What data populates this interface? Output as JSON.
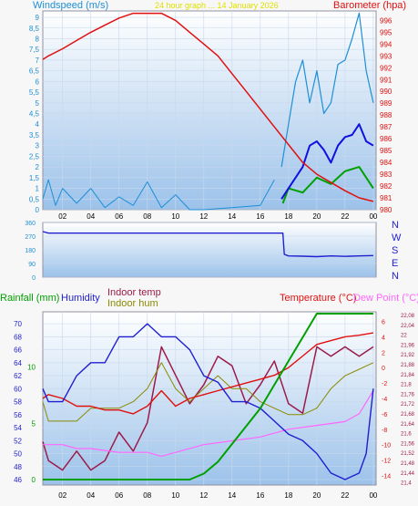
{
  "colors": {
    "wind": "#1e8fd6",
    "wind_avg": "#1010e0",
    "barometer": "#e01010",
    "green": "#00a000",
    "indoor_temp": "#9b1b4b",
    "indoor_hum": "#8a8a00",
    "temperature": "#e01010",
    "dewpoint": "#ff66ff",
    "humidity": "#1f1fd0",
    "rain": "#00a000"
  },
  "chart_data": [
    {
      "type": "line",
      "title": "24 hour graph ... 14 January 2026",
      "ylabel_left": "Windspeed (m/s)",
      "ylabel_right": "Barometer (hpa)",
      "x_ticks": [
        "02",
        "04",
        "06",
        "08",
        "10",
        "12",
        "14",
        "16",
        "18",
        "20",
        "22",
        "00"
      ],
      "y_left_ticks": [
        "0",
        "0,5",
        "1",
        "1,5",
        "2",
        "2,5",
        "3",
        "3,5",
        "4",
        "4,5",
        "5",
        "5,5",
        "6",
        "6,5",
        "7",
        "7,5",
        "8",
        "8,5",
        "9"
      ],
      "y_right_ticks": [
        "980",
        "981",
        "982",
        "983",
        "984",
        "985",
        "986",
        "987",
        "988",
        "989",
        "990",
        "991",
        "992",
        "993",
        "994",
        "995",
        "996"
      ],
      "ylim_left": [
        0,
        9.3
      ],
      "ylim_right": [
        980,
        996.8
      ],
      "xlim": [
        0.6,
        24.2
      ],
      "barometer_series": [
        [
          0.6,
          992.7
        ],
        [
          1,
          993
        ],
        [
          2,
          993.6
        ],
        [
          3,
          994.3
        ],
        [
          4,
          995
        ],
        [
          5,
          995.6
        ],
        [
          6,
          996.2
        ],
        [
          7,
          996.6
        ],
        [
          8,
          996.6
        ],
        [
          9,
          996.6
        ],
        [
          10,
          996
        ],
        [
          11,
          995
        ],
        [
          12,
          994
        ],
        [
          13,
          993
        ],
        [
          14,
          991.5
        ],
        [
          15,
          990
        ],
        [
          16,
          988.5
        ],
        [
          17,
          987
        ],
        [
          18,
          985.5
        ],
        [
          19,
          984
        ],
        [
          20,
          983
        ],
        [
          21,
          982.3
        ],
        [
          22,
          981.6
        ],
        [
          23,
          981
        ],
        [
          24,
          980.7
        ]
      ],
      "wind_avg_series": [
        [
          17.5,
          0.5
        ],
        [
          18,
          1
        ],
        [
          18.5,
          1.5
        ],
        [
          19,
          2
        ],
        [
          19.5,
          3
        ],
        [
          20,
          3.2
        ],
        [
          20.5,
          2.8
        ],
        [
          21,
          2.2
        ],
        [
          21.5,
          3
        ],
        [
          22,
          3.4
        ],
        [
          22.5,
          3.5
        ],
        [
          23,
          4
        ],
        [
          23.5,
          3.2
        ],
        [
          24,
          3
        ]
      ],
      "gust_series": [
        [
          17.5,
          2
        ],
        [
          18,
          4
        ],
        [
          18.5,
          6
        ],
        [
          19,
          7
        ],
        [
          19.5,
          5
        ],
        [
          20,
          6.5
        ],
        [
          20.5,
          4.5
        ],
        [
          21,
          5
        ],
        [
          21.5,
          6.8
        ],
        [
          22,
          7
        ],
        [
          22.5,
          8
        ],
        [
          23,
          9.2
        ],
        [
          23.5,
          6.5
        ],
        [
          24,
          5
        ]
      ],
      "green_series": [
        [
          17.6,
          0.3
        ],
        [
          18,
          1
        ],
        [
          19,
          0.8
        ],
        [
          20,
          1.5
        ],
        [
          21,
          1.2
        ],
        [
          22,
          1.8
        ],
        [
          23,
          2
        ],
        [
          24,
          1
        ]
      ],
      "wind_early_series": [
        [
          0.6,
          0.5
        ],
        [
          1,
          1.4
        ],
        [
          1.5,
          0.2
        ],
        [
          2,
          1
        ],
        [
          3,
          0.3
        ],
        [
          4,
          1
        ],
        [
          5,
          0.1
        ],
        [
          6,
          0.6
        ],
        [
          7,
          0.2
        ],
        [
          8,
          1.3
        ],
        [
          9,
          0.1
        ],
        [
          10,
          0.7
        ],
        [
          11,
          0
        ],
        [
          12,
          0
        ],
        [
          14,
          0.1
        ],
        [
          16,
          0.2
        ],
        [
          17,
          1.4
        ]
      ]
    },
    {
      "type": "line",
      "title": "Wind direction",
      "y_ticks": [
        "0",
        "90",
        "180",
        "270",
        "360"
      ],
      "y_labels_right": [
        "N",
        "W",
        "S",
        "E",
        "N"
      ],
      "ylim": [
        0,
        360
      ],
      "xlim": [
        0.6,
        24.2
      ],
      "direction_series": [
        [
          0.6,
          300
        ],
        [
          1,
          290
        ],
        [
          2,
          290
        ],
        [
          4,
          290
        ],
        [
          6,
          290
        ],
        [
          8,
          290
        ],
        [
          10,
          290
        ],
        [
          12,
          290
        ],
        [
          14,
          290
        ],
        [
          16,
          290
        ],
        [
          17.6,
          290
        ],
        [
          17.7,
          150
        ],
        [
          18,
          140
        ],
        [
          19,
          138
        ],
        [
          20,
          135
        ],
        [
          21,
          140
        ],
        [
          22,
          137
        ],
        [
          23,
          140
        ],
        [
          24,
          142
        ]
      ]
    },
    {
      "type": "line",
      "labels": {
        "rainfall": "Rainfall (mm)",
        "humidity": "Humidity",
        "indoor_temp": "Indoor temp",
        "indoor_hum": "Indoor hum",
        "temperature": "Temperature (°C)",
        "dewpoint": "Dew Point (°C)"
      },
      "x_ticks": [
        "02",
        "04",
        "06",
        "08",
        "10",
        "12",
        "14",
        "16",
        "18",
        "20",
        "22",
        "00"
      ],
      "humidity_ticks": [
        "46",
        "48",
        "50",
        "52",
        "54",
        "56",
        "58",
        "60",
        "62",
        "64",
        "66",
        "68",
        "70"
      ],
      "rain_ticks": [
        "0",
        "5",
        "10"
      ],
      "temp_ticks": [
        "6",
        "4",
        "2",
        "0",
        "-2",
        "-4",
        "-6",
        "-8",
        "-10",
        "-12",
        "-14"
      ],
      "indoor_ticks": [
        "22,08",
        "22,04",
        "22",
        "21,96",
        "21,92",
        "21,88",
        "21,84",
        "21,8",
        "21,76",
        "21,72",
        "21,68",
        "21,64",
        "21,6",
        "21,56",
        "21,52",
        "21,48",
        "21,44",
        "21,4"
      ],
      "xlim": [
        0.6,
        24.2
      ],
      "humidity_ylim": [
        46,
        71
      ],
      "rain_ylim": [
        0,
        14
      ],
      "temp_ylim": [
        -15,
        7
      ],
      "humidity_series": [
        [
          0.6,
          60
        ],
        [
          1,
          58
        ],
        [
          2,
          58
        ],
        [
          3,
          62
        ],
        [
          4,
          64
        ],
        [
          5,
          64
        ],
        [
          6,
          68
        ],
        [
          7,
          68
        ],
        [
          8,
          70
        ],
        [
          9,
          68
        ],
        [
          10,
          68
        ],
        [
          11,
          66
        ],
        [
          12,
          62
        ],
        [
          13,
          61
        ],
        [
          14,
          58
        ],
        [
          15,
          58
        ],
        [
          16,
          57
        ],
        [
          17,
          55
        ],
        [
          18,
          53
        ],
        [
          19,
          52
        ],
        [
          20,
          50
        ],
        [
          21,
          47
        ],
        [
          22,
          46
        ],
        [
          23,
          47
        ],
        [
          23.5,
          50
        ],
        [
          24,
          60
        ]
      ],
      "temperature_series": [
        [
          0.6,
          -4
        ],
        [
          1,
          -3.5
        ],
        [
          2,
          -4
        ],
        [
          3,
          -5
        ],
        [
          4,
          -5
        ],
        [
          5,
          -5.5
        ],
        [
          6,
          -5.5
        ],
        [
          7,
          -6
        ],
        [
          8,
          -5
        ],
        [
          9,
          -3
        ],
        [
          10,
          -5
        ],
        [
          11,
          -4
        ],
        [
          12,
          -3.5
        ],
        [
          13,
          -3
        ],
        [
          14,
          -2.5
        ],
        [
          15,
          -2
        ],
        [
          16,
          -1.5
        ],
        [
          17,
          -1
        ],
        [
          18,
          0
        ],
        [
          19,
          1.5
        ],
        [
          20,
          3
        ],
        [
          21,
          3.5
        ],
        [
          22,
          4
        ],
        [
          23,
          4.2
        ],
        [
          24,
          4.5
        ]
      ],
      "dewpoint_series": [
        [
          0.6,
          -10
        ],
        [
          2,
          -10
        ],
        [
          3,
          -10.5
        ],
        [
          4,
          -10.5
        ],
        [
          6,
          -11
        ],
        [
          8,
          -11
        ],
        [
          9,
          -11.5
        ],
        [
          10,
          -11
        ],
        [
          12,
          -10
        ],
        [
          14,
          -9.5
        ],
        [
          16,
          -9
        ],
        [
          18,
          -8
        ],
        [
          20,
          -7.5
        ],
        [
          22,
          -7
        ],
        [
          23,
          -6
        ],
        [
          24,
          -3
        ]
      ],
      "rain_series": [
        [
          0.6,
          0
        ],
        [
          11,
          0
        ],
        [
          12,
          0.5
        ],
        [
          13,
          1.5
        ],
        [
          14,
          3
        ],
        [
          15,
          4.5
        ],
        [
          16,
          6
        ],
        [
          17,
          8
        ],
        [
          18,
          10
        ],
        [
          19,
          12
        ],
        [
          20,
          14
        ],
        [
          24,
          14
        ]
      ],
      "indoor_temp_series": [
        [
          0.6,
          21.56
        ],
        [
          1,
          21.48
        ],
        [
          2,
          21.44
        ],
        [
          3,
          21.52
        ],
        [
          4,
          21.44
        ],
        [
          5,
          21.48
        ],
        [
          6,
          21.6
        ],
        [
          7,
          21.52
        ],
        [
          8,
          21.64
        ],
        [
          9,
          21.96
        ],
        [
          10,
          21.84
        ],
        [
          11,
          21.72
        ],
        [
          12,
          21.8
        ],
        [
          13,
          21.92
        ],
        [
          14,
          21.88
        ],
        [
          15,
          21.72
        ],
        [
          16,
          21.8
        ],
        [
          17,
          21.9
        ],
        [
          18,
          21.72
        ],
        [
          19,
          21.68
        ],
        [
          20,
          21.96
        ],
        [
          21,
          21.92
        ],
        [
          22,
          21.96
        ],
        [
          23,
          21.92
        ],
        [
          24,
          21.96
        ]
      ],
      "indoor_hum_series": [
        [
          0.6,
          58
        ],
        [
          1,
          55
        ],
        [
          2,
          55
        ],
        [
          3,
          55
        ],
        [
          4,
          57
        ],
        [
          5,
          57
        ],
        [
          6,
          57
        ],
        [
          7,
          58
        ],
        [
          8,
          60
        ],
        [
          9,
          64
        ],
        [
          10,
          60
        ],
        [
          11,
          58
        ],
        [
          12,
          60
        ],
        [
          13,
          62
        ],
        [
          14,
          60
        ],
        [
          15,
          60
        ],
        [
          16,
          58
        ],
        [
          17,
          57
        ],
        [
          18,
          56
        ],
        [
          19,
          56
        ],
        [
          20,
          57
        ],
        [
          21,
          60
        ],
        [
          22,
          62
        ],
        [
          23,
          63
        ],
        [
          24,
          64
        ]
      ]
    }
  ]
}
